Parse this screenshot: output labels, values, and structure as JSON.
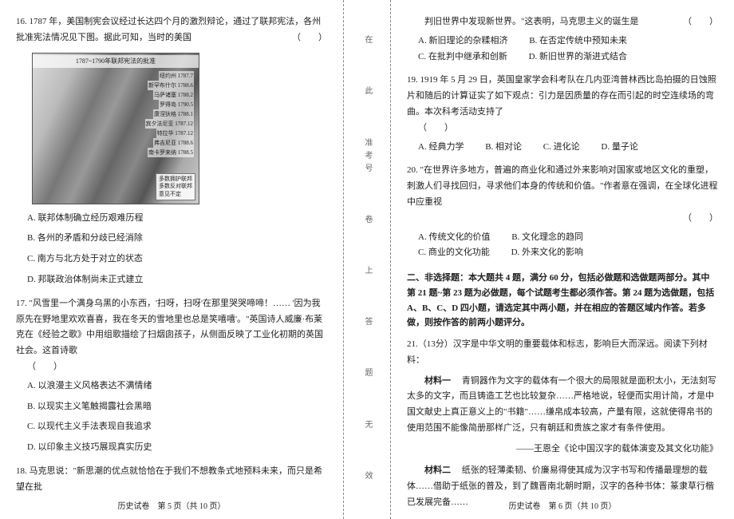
{
  "binding": {
    "t1": "在",
    "t2": "此",
    "t3": "卷",
    "t4": "上",
    "t5": "答",
    "t6": "题",
    "t7": "无",
    "t8": "效",
    "mid": "准考号"
  },
  "left": {
    "q16": {
      "stem": "16. 1787 年，美国制宪会议经过长达四个月的激烈辩论，通过了联邦宪法，各州批准宪法情况见下图。据此可知，当时的美国",
      "paren": "（　　）",
      "map_title": "1787~1790年联邦宪法的批准",
      "map_labels": {
        "l1": "纽约州 1787.7",
        "l2": "新罕布什尔 1788.6",
        "l3": "马萨诸塞 1788.2",
        "l4": "罗得岛 1790.5",
        "l5": "康涅狄格 1788.1",
        "l6": "宾夕法尼亚 1787.12",
        "l7": "特拉华 1787.12",
        "l8": "弗吉尼亚 1788.6",
        "l9": "南卡罗来纳 1788.5"
      },
      "legend": {
        "a": "多数拥护联邦",
        "b": "多数反对联邦",
        "c": "意见不定"
      },
      "optA": "A. 联邦体制确立经历艰难历程",
      "optB": "B. 各州的矛盾和分歧已经消除",
      "optC": "C. 南方与北方处于对立的状态",
      "optD": "D. 邦联政治体制尚未正式建立"
    },
    "q17": {
      "stem": "17. \"风雪里一个满身乌黑的小东西，'扫呀，扫呀'在那里哭哭啼啼！…… '因为我原先在野地里欢欢喜喜，我在冬天的雪地里也总是笑嘻嘻'。\"英国诗人威廉·布莱克在《经验之歌》中用组歌描绘了扫烟囱孩子，从侧面反映了工业化初期的英国社会。这首诗歌",
      "paren": "（　　）",
      "optA": "A. 以浪漫主义风格表达不满情绪",
      "optB": "B. 以现实主义笔触揭露社会黑暗",
      "optC": "C. 以现代主义手法表现自我追求",
      "optD": "D. 以印象主义技巧展现真实历史"
    },
    "q18": {
      "stem": "18. 马克思说：\"新思潮的优点就恰恰在于我们不想教条式地预料未来，而只是希望在批"
    },
    "footer": "历史试卷　第 5 页（共 10 页）"
  },
  "right": {
    "q18cont": {
      "stem": "判旧世界中发现新世界。\"这表明，马克思主义的诞生是",
      "paren": "（　　）",
      "optA": "A. 新旧理论的杂糅相济",
      "optB": "B. 在否定传统中预知未来",
      "optC": "C. 在批判中继承和创新",
      "optD": "D. 新旧世界的渐进式结合"
    },
    "q19": {
      "stem": "19. 1919 年 5 月 29 日，英国皇家学会科考队在几内亚湾普林西比岛拍摄的日蚀照片和随后的计算证实了如下观点：引力是因质量的存在而引起的时空连续场的弯曲。本次科考活动支持了",
      "paren": "（　　）",
      "optA": "A. 经典力学",
      "optB": "B. 相对论",
      "optC": "C. 进化论",
      "optD": "D. 量子论"
    },
    "q20": {
      "stem": "20. \"在世界许多地方，普遍的商业化和通过外来影响对国家或地区文化的重塑，刺激人们寻找回归，寻求他们本身的传统和价值。\"作者意在强调，在全球化进程中应重视",
      "paren": "（　　）",
      "optA": "A. 传统文化的价值",
      "optB": "B. 文化理念的趋同",
      "optC": "C. 商业的文化功能",
      "optD": "D. 外来文化的影响"
    },
    "section2": {
      "title": "二、非选择题：本大题共 4 题，满分 60 分，包括必做题和选做题两部分。其中第 21 题~第 23 题为必做题，每个试题考生都必须作答。第 24 题为选做题，包括 A、B、C、D 四小题，请选定其中两小题，并在相应的答题区域内作答。若多做，则按作答的前两小题评分。"
    },
    "q21": {
      "stem": "21.（13分）汉字是中华文明的重要载体和标志，影响巨大而深远。阅读下列材料：",
      "mat1_label": "材料一",
      "mat1": "　青铜器作为文字的载体有一个很大的局限就是面积太小，无法刻写太多的文字，而且铸造工艺也比较复杂……严格地说，轻便而实用计简，才是中国文献史上真正意义上的\"书籍\"……缣帛成本较高，产量有限，这就使得帛书的使用范围不能像简册那样广泛，只有朝廷和贵族之家才有条件使用。",
      "src1": "——王恩全《论中国汉字的载体演变及其文化功能》",
      "mat2_label": "材料二",
      "mat2": "　纸张的轻薄柔韧、价廉易得使其成为汉字书写和传播最理想的载体……借助于纸张的普及，到了魏晋南北朝时期，汉字的各种书体：篆隶草行楷已发展完备……"
    },
    "footer": "历史试卷　第 6 页（共 10 页）"
  }
}
